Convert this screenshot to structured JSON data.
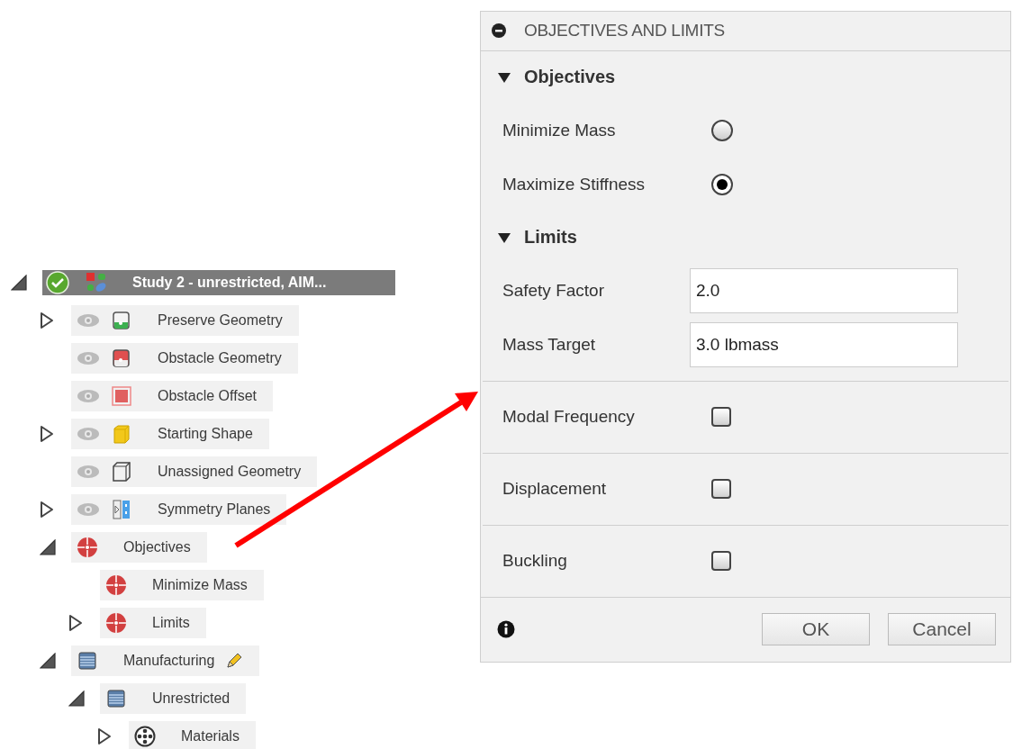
{
  "tree": {
    "label": "Study 2 - unrestricted, AIM...",
    "kind": "study",
    "expanded": true,
    "selected": true,
    "children": [
      {
        "label": "Preserve Geometry",
        "kind": "preserve",
        "expanded": false,
        "visible": true,
        "selected": false
      },
      {
        "label": "Obstacle Geometry",
        "kind": "obstacle",
        "visible": true,
        "selected": false
      },
      {
        "label": "Obstacle Offset",
        "kind": "offset",
        "visible": true,
        "selected": false
      },
      {
        "label": "Starting Shape",
        "kind": "starting",
        "expanded": false,
        "visible": true,
        "selected": false
      },
      {
        "label": "Unassigned Geometry",
        "kind": "unassigned",
        "visible": true,
        "selected": false
      },
      {
        "label": "Symmetry Planes",
        "kind": "symmetry",
        "expanded": false,
        "visible": true,
        "selected": false
      },
      {
        "label": "Objectives",
        "kind": "objective",
        "expanded": true,
        "selected": false,
        "children": [
          {
            "label": "Minimize Mass",
            "kind": "objective",
            "selected": false
          },
          {
            "label": "Limits",
            "kind": "objective",
            "expanded": false,
            "selected": false
          }
        ]
      },
      {
        "label": "Manufacturing",
        "kind": "manufacturing",
        "expanded": true,
        "editable": true,
        "selected": false,
        "children": [
          {
            "label": "Unrestricted",
            "kind": "manufacturing",
            "expanded": true,
            "selected": false,
            "children": [
              {
                "label": "Materials",
                "kind": "materials",
                "expanded": false,
                "selected": false
              }
            ]
          }
        ]
      }
    ]
  },
  "panel": {
    "title": "OBJECTIVES AND LIMITS",
    "expanded": true,
    "sections": [
      {
        "title": "Objectives",
        "expanded": true,
        "rows": [
          {
            "kind": "radio",
            "label": "Minimize Mass",
            "selected": false
          },
          {
            "kind": "radio",
            "label": "Maximize Stiffness",
            "selected": true
          }
        ]
      },
      {
        "title": "Limits",
        "expanded": true,
        "rows": [
          {
            "kind": "field",
            "label": "Safety Factor",
            "value": "2.0"
          },
          {
            "kind": "field",
            "label": "Mass Target",
            "value": "3.0 lbmass"
          },
          {
            "kind": "checkbox",
            "label": "Modal Frequency",
            "checked": false
          },
          {
            "kind": "checkbox",
            "label": "Displacement",
            "checked": false
          },
          {
            "kind": "checkbox",
            "label": "Buckling",
            "checked": false
          }
        ]
      }
    ],
    "buttons": [
      {
        "label": "OK"
      },
      {
        "label": "Cancel"
      }
    ]
  }
}
